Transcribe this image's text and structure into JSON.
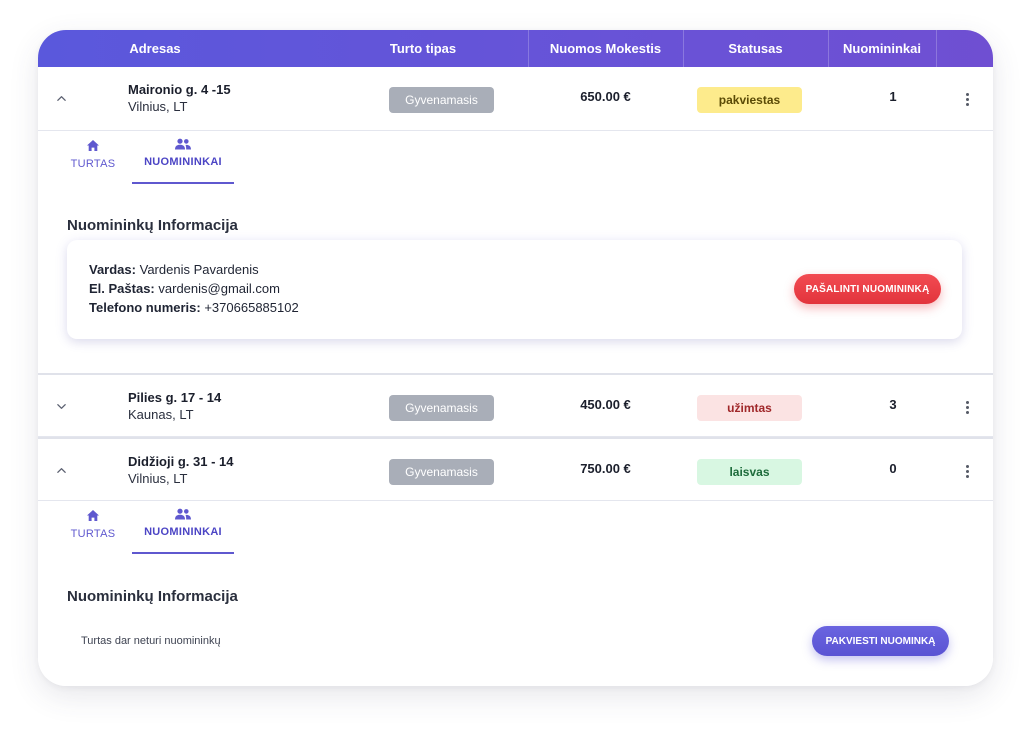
{
  "table": {
    "columns": [
      "Adresas",
      "Turto tipas",
      "Nuomos Mokestis",
      "Statusas",
      "Nuomininkai"
    ],
    "rows": [
      {
        "street": "Maironio g. 4 -15",
        "city": "Vilnius, LT",
        "type": "Gyvenamasis",
        "fee": "650.00 €",
        "status": "pakviestas",
        "status_colors": {
          "bg": "#fdeb8c",
          "fg": "#5a4a06"
        },
        "tenants": "1",
        "expanded": true
      },
      {
        "street": "Pilies g. 17 - 14",
        "city": "Kaunas, LT",
        "type": "Gyvenamasis",
        "fee": "450.00 €",
        "status": "užimtas",
        "status_colors": {
          "bg": "#fbe3e3",
          "fg": "#a0282a"
        },
        "tenants": "3",
        "expanded": false
      },
      {
        "street": "Didžioji g. 31 - 14",
        "city": "Vilnius, LT",
        "type": "Gyvenamasis",
        "fee": "750.00 €",
        "status": "laisvas",
        "status_colors": {
          "bg": "#d8f7e2",
          "fg": "#1d6b3b"
        },
        "tenants": "0",
        "expanded": true
      }
    ]
  },
  "detail_tabs": {
    "property_label": "TURTAS",
    "tenants_label": "NUOMININKAI",
    "active": "NUOMININKAI"
  },
  "panel_one": {
    "title": "Nuomininkų Informacija",
    "tenant": {
      "name_label": "Vardas:",
      "name": "Vardenis Pavardenis",
      "email_label": "El. Paštas:",
      "email": "vardenis@gmail.com",
      "phone_label": "Telefono numeris:",
      "phone": "+370665885102"
    },
    "remove_button": "PAŠALINTI NUOMININKĄ"
  },
  "panel_two": {
    "title": "Nuomininkų Informacija",
    "empty_text": "Turtas dar neturi nuomininkų",
    "invite_button": "PAKVIESTI NUOMINKĄ"
  },
  "colors": {
    "accent": "#5f58cf",
    "header_gradient_start": "#5a58dc",
    "header_gradient_end": "#6f4fd2",
    "type_badge": "#a9aeb8",
    "danger": "#e8393f"
  },
  "icons": {
    "collapse": "chevron-up-icon",
    "expand": "chevron-down-icon",
    "menu": "kebab-menu-icon",
    "property_tab": "home-icon",
    "tenants_tab": "people-icon"
  }
}
